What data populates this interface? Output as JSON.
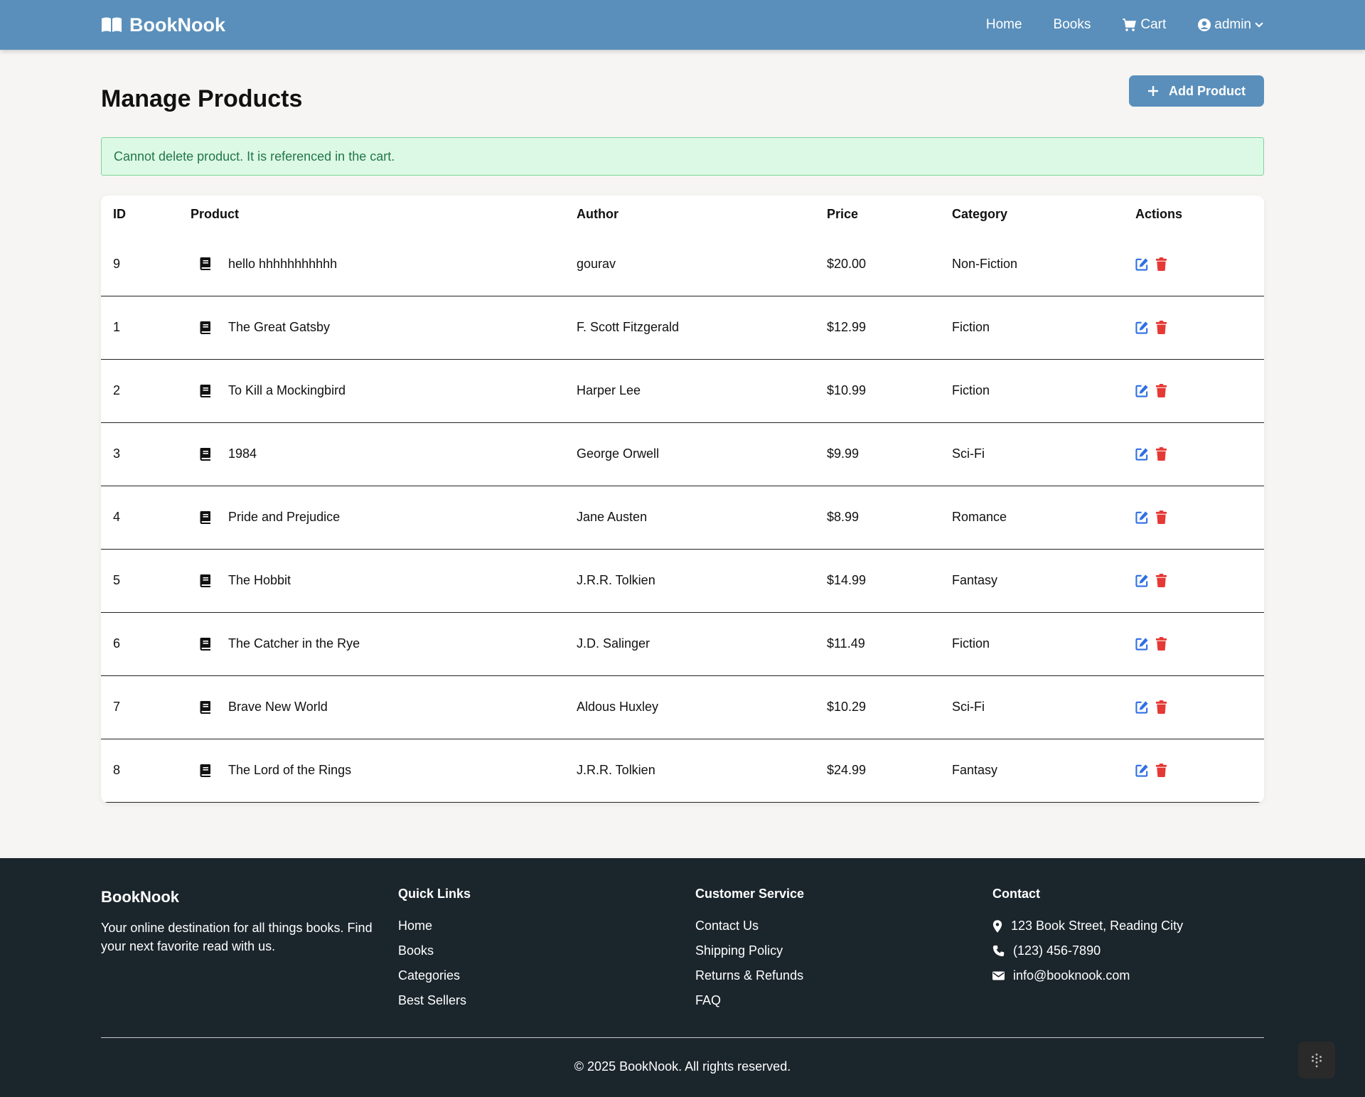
{
  "navbar": {
    "brand": "BookNook",
    "links": {
      "home": "Home",
      "books": "Books",
      "cart": "Cart",
      "user": "admin"
    }
  },
  "page": {
    "title": "Manage Products",
    "add_button": "Add Product",
    "alert": "Cannot delete product. It is referenced in the cart."
  },
  "table": {
    "headers": {
      "id": "ID",
      "product": "Product",
      "author": "Author",
      "price": "Price",
      "category": "Category",
      "actions": "Actions"
    },
    "rows": [
      {
        "id": "9",
        "product": "hello hhhhhhhhhhh",
        "author": "gourav",
        "price": "$20.00",
        "category": "Non-Fiction"
      },
      {
        "id": "1",
        "product": "The Great Gatsby",
        "author": "F. Scott Fitzgerald",
        "price": "$12.99",
        "category": "Fiction"
      },
      {
        "id": "2",
        "product": "To Kill a Mockingbird",
        "author": "Harper Lee",
        "price": "$10.99",
        "category": "Fiction"
      },
      {
        "id": "3",
        "product": "1984",
        "author": "George Orwell",
        "price": "$9.99",
        "category": "Sci-Fi"
      },
      {
        "id": "4",
        "product": "Pride and Prejudice",
        "author": "Jane Austen",
        "price": "$8.99",
        "category": "Romance"
      },
      {
        "id": "5",
        "product": "The Hobbit",
        "author": "J.R.R. Tolkien",
        "price": "$14.99",
        "category": "Fantasy"
      },
      {
        "id": "6",
        "product": "The Catcher in the Rye",
        "author": "J.D. Salinger",
        "price": "$11.49",
        "category": "Fiction"
      },
      {
        "id": "7",
        "product": "Brave New World",
        "author": "Aldous Huxley",
        "price": "$10.29",
        "category": "Sci-Fi"
      },
      {
        "id": "8",
        "product": "The Lord of the Rings",
        "author": "J.R.R. Tolkien",
        "price": "$24.99",
        "category": "Fantasy"
      }
    ]
  },
  "footer": {
    "brand": "BookNook",
    "tagline": "Your online destination for all things books. Find your next favorite read with us.",
    "quick_links": {
      "title": "Quick Links",
      "items": [
        "Home",
        "Books",
        "Categories",
        "Best Sellers"
      ]
    },
    "customer_service": {
      "title": "Customer Service",
      "items": [
        "Contact Us",
        "Shipping Policy",
        "Returns & Refunds",
        "FAQ"
      ]
    },
    "contact": {
      "title": "Contact",
      "address": "123 Book Street, Reading City",
      "phone": "(123) 456-7890",
      "email": "info@booknook.com"
    },
    "copyright": "© 2025 BookNook. All rights reserved."
  },
  "colors": {
    "primary": "#5a8fbb",
    "edit": "#2f6fe4",
    "delete": "#e53935",
    "footer_bg": "#1b252c",
    "alert_bg": "#dcf9e5",
    "alert_text": "#22774a"
  },
  "icons": {
    "brand": "open-book-icon",
    "cart": "cart-icon",
    "user": "user-circle-icon",
    "row": "book-icon",
    "edit": "edit-icon",
    "delete": "trash-icon",
    "address": "map-pin-icon",
    "phone": "phone-icon",
    "email": "envelope-icon"
  }
}
